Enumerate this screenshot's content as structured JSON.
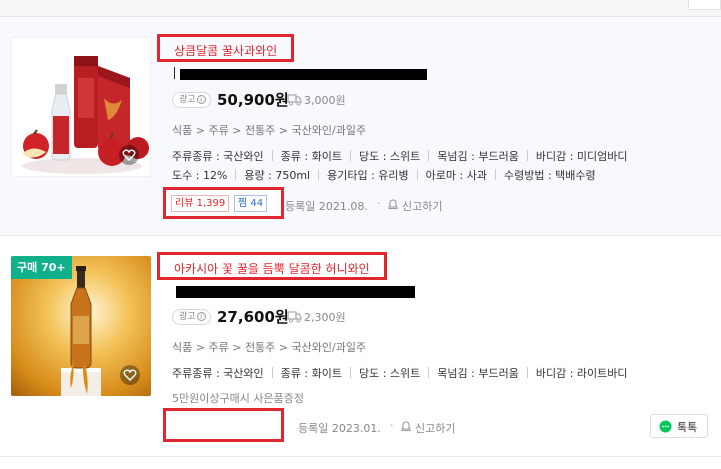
{
  "products": [
    {
      "title": "상큼달콤 꿀사과와인",
      "ad_label": "광고",
      "price": "50,900원",
      "shipping": "3,000원",
      "category": [
        "식품",
        "주류",
        "전통주",
        "국산와인/과일주"
      ],
      "specs_line1": [
        "주류종류 : 국산와인",
        "종류 : 화이트",
        "당도 : 스위트",
        "목넘김 : 부드러움",
        "바디감 : 미디엄바디"
      ],
      "specs_line2": [
        "도수 : 12%",
        "용량 : 750ml",
        "용기타입 : 유리병",
        "아로마 : 사과",
        "수령방법 : 택배수령"
      ],
      "review_label": "리뷰 1,399",
      "zzim_label": "찜 44",
      "reg_date": "등록일 2021.08.",
      "report_label": "신고하기"
    },
    {
      "buy_badge": "구매 70+",
      "title": "아카시아 꽃 꿀을 듬뿍 달콤한 허니와인",
      "ad_label": "광고",
      "price": "27,600원",
      "shipping": "2,300원",
      "category": [
        "식품",
        "주류",
        "전통주",
        "국산와인/과일주"
      ],
      "specs_line1": [
        "주류종류 : 국산와인",
        "종류 : 화이트",
        "당도 : 스위트",
        "목넘김 : 부드러움",
        "바디감 : 라이트바디"
      ],
      "gift": "5만원이상구매시 사은품증정",
      "reg_date": "등록일 2023.01.",
      "report_label": "신고하기",
      "talk_label": "톡톡"
    }
  ],
  "colors": {
    "highlight": "#e0262e",
    "review": "#e0262e",
    "zzim": "#2a6cd6",
    "talk": "#03c75a",
    "buy_badge": "#0fb08a"
  },
  "icons": [
    "heart-icon",
    "info-icon",
    "truck-icon",
    "bell-icon",
    "talk-icon"
  ]
}
